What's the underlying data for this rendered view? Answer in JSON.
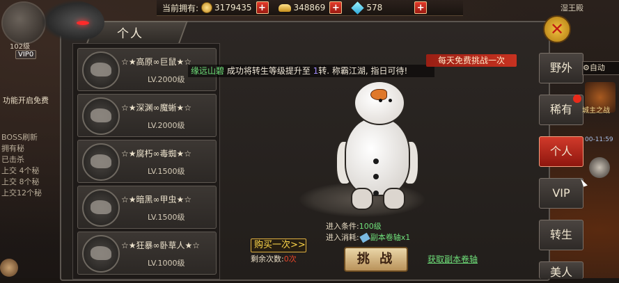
{
  "topbar": {
    "label": "当前拥有:",
    "gold": "3179435",
    "ingot": "348869",
    "diamond": "578",
    "corner": "湿王殿"
  },
  "hud": {
    "level": "102级",
    "vip": "VIP0",
    "func_notice": "功能开启免费",
    "boss_lines": [
      "BOSS刷新",
      "拥有秘",
      "已击杀",
      "上交 4个秘",
      "上交 8个秘",
      "上交12个秘"
    ]
  },
  "panel": {
    "title": "个人"
  },
  "broadcast": {
    "who": "缘远山碧",
    "text": " 成功将转生等级提升至 ",
    "num": "1",
    "tail": "转. 称霸江湖, 指日可待!"
  },
  "daily_banner": "每天免费挑战一次",
  "bosses": [
    {
      "name": "☆★高原∞巨鼠★☆",
      "level": "LV.2000级"
    },
    {
      "name": "☆★深渊∞魔蜥★☆",
      "level": "LV.2000级"
    },
    {
      "name": "☆★腐朽∞毒蜘★☆",
      "level": "LV.1500级"
    },
    {
      "name": "☆★暗黑∞甲虫★☆",
      "level": "LV.1500级"
    },
    {
      "name": "☆★狂暴∞卧草人★☆",
      "level": "LV.1000级"
    }
  ],
  "info": {
    "cond_label": "进入条件:",
    "cond_value": "100级",
    "cost_label": "进入消耗:",
    "cost_value": "副本卷轴x1"
  },
  "buy_button": "购买一次>>",
  "remain_label": "剩余次数:",
  "remain_value": "0次",
  "fight_button": "挑 战",
  "get_scroll_link": "获取副本卷轴",
  "side_tabs": [
    "野外",
    "稀有",
    "个人",
    "VIP",
    "转生",
    "美人"
  ],
  "active_tab": "个人",
  "right_hud": {
    "auto_label": "自动",
    "city_label": "城主之战",
    "time": "00-11:59"
  },
  "colors": {
    "accent_red": "#c73220",
    "highlight_green": "#6fe07a",
    "gold": "#ffd84a"
  }
}
